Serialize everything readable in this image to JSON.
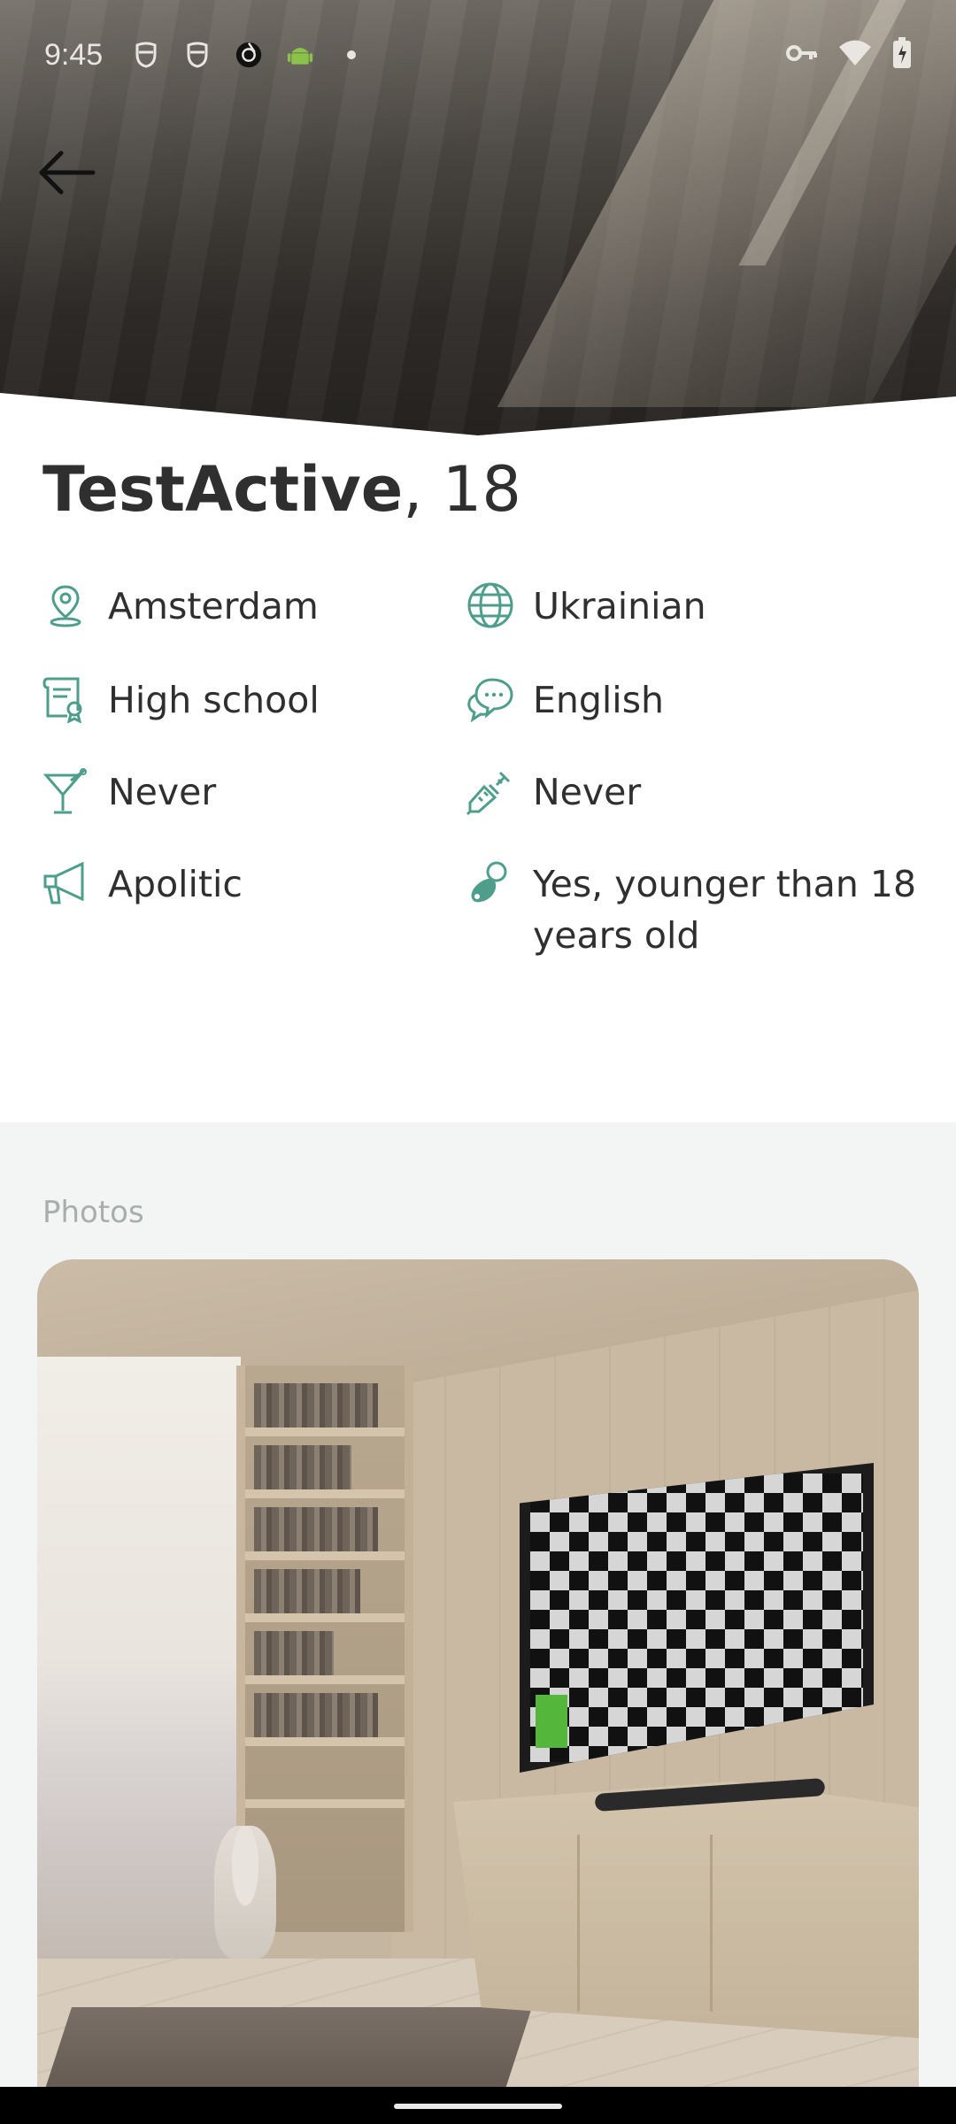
{
  "status_bar": {
    "time": "9:45",
    "icons_left": [
      "privacy-mask-icon",
      "privacy-mask-icon",
      "camera-shutter-icon",
      "android-icon",
      "dot-icon"
    ],
    "icons_right": [
      "vpn-key-icon",
      "wifi-icon",
      "battery-icon"
    ]
  },
  "header": {
    "back_icon": "arrow-left-icon"
  },
  "profile": {
    "name": "TestActive",
    "age": ", 18",
    "details": [
      {
        "icon": "location-pin-icon",
        "label": "Amsterdam"
      },
      {
        "icon": "globe-icon",
        "label": "Ukrainian"
      },
      {
        "icon": "diploma-icon",
        "label": "High school"
      },
      {
        "icon": "chat-bubbles-icon",
        "label": "English"
      },
      {
        "icon": "cocktail-icon",
        "label": "Never"
      },
      {
        "icon": "syringe-icon",
        "label": "Never"
      },
      {
        "icon": "megaphone-icon",
        "label": "Apolitic"
      },
      {
        "icon": "pacifier-icon",
        "label": "Yes, younger than 18 years old"
      }
    ]
  },
  "photos": {
    "label": "Photos"
  },
  "colors": {
    "accent": "#4f9e8c",
    "text": "#2f2f2f",
    "muted": "#a9aeac",
    "section_bg": "#f2f5f4"
  }
}
